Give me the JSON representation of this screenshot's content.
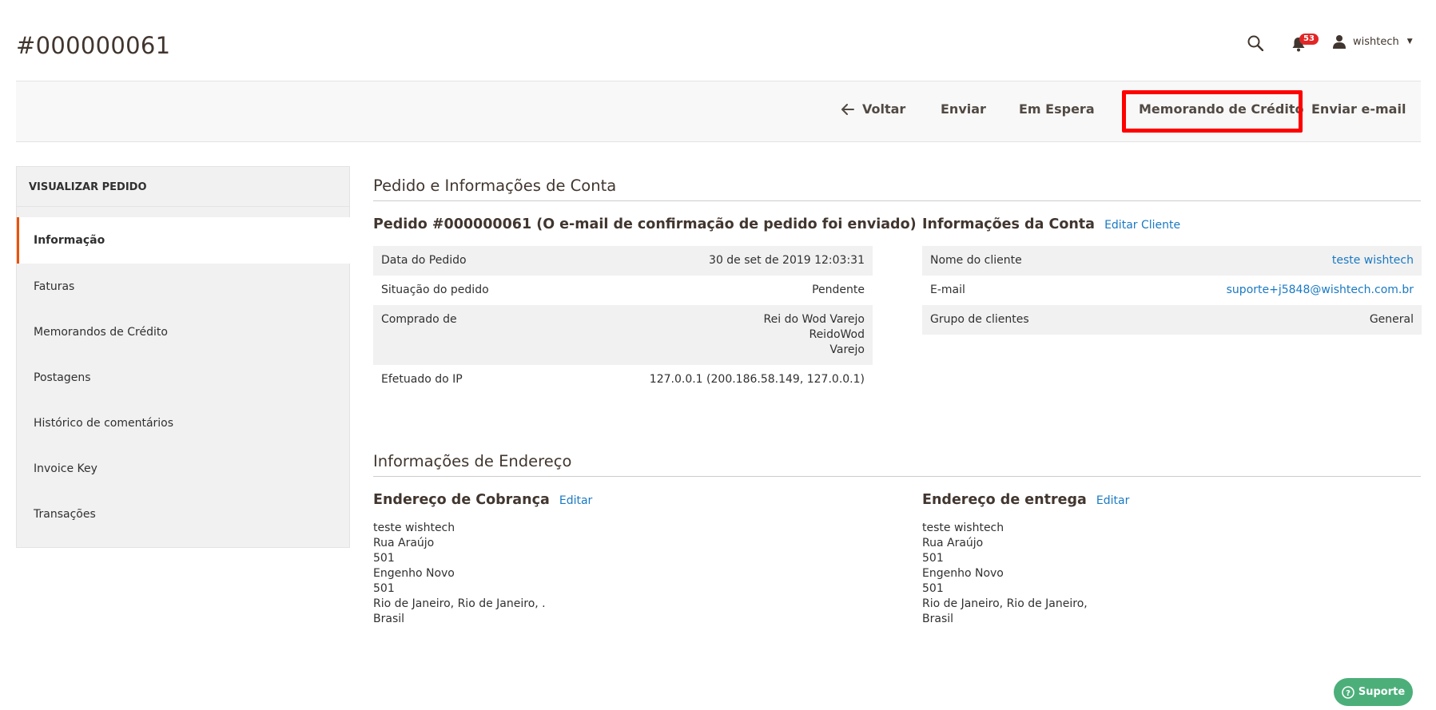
{
  "header": {
    "title": "#000000061",
    "notification_count": "53",
    "user_name": "wishtech"
  },
  "actions": {
    "back": "Voltar",
    "ship": "Enviar",
    "hold": "Em Espera",
    "credit_memo": "Memorando de Crédito",
    "send_email": "Enviar e-mail"
  },
  "sidebar": {
    "title": "VISUALIZAR PEDIDO",
    "items": [
      {
        "label": "Informação"
      },
      {
        "label": "Faturas"
      },
      {
        "label": "Memorandos de Crédito"
      },
      {
        "label": "Postagens"
      },
      {
        "label": "Histórico de comentários"
      },
      {
        "label": "Invoice Key"
      },
      {
        "label": "Transações"
      }
    ]
  },
  "order_section": {
    "title": "Pedido e Informações de Conta",
    "order": {
      "title": "Pedido #000000061 (O e-mail de confirmação de pedido foi enviado)",
      "rows": [
        {
          "label": "Data do Pedido",
          "value": "30 de set de 2019 12:03:31"
        },
        {
          "label": "Situação do pedido",
          "value": "Pendente"
        },
        {
          "label": "Comprado de",
          "value_lines": [
            "Rei do Wod Varejo",
            "ReidoWod",
            "Varejo"
          ]
        },
        {
          "label": "Efetuado do IP",
          "value": "127.0.0.1 (200.186.58.149, 127.0.0.1)"
        }
      ]
    },
    "account": {
      "title": "Informações da Conta",
      "edit_link": "Editar Cliente",
      "rows": [
        {
          "label": "Nome do cliente",
          "value": "teste wishtech"
        },
        {
          "label": "E-mail",
          "value": "suporte+j5848@wishtech.com.br"
        },
        {
          "label": "Grupo de clientes",
          "value": "General"
        }
      ]
    }
  },
  "address_section": {
    "title": "Informações de Endereço",
    "billing": {
      "title": "Endereço de Cobrança",
      "edit_link": "Editar",
      "lines": [
        "teste wishtech",
        "Rua Araújo",
        "501",
        "Engenho Novo",
        "501",
        "Rio de Janeiro, Rio de Janeiro, .",
        "Brasil"
      ]
    },
    "shipping": {
      "title": "Endereço de entrega",
      "edit_link": "Editar",
      "lines": [
        "teste wishtech",
        "Rua Araújo",
        "501",
        "Engenho Novo",
        "501",
        "Rio de Janeiro, Rio de Janeiro,",
        "Brasil"
      ]
    }
  },
  "support_button": "Suporte",
  "colors": {
    "accent_orange": "#eb5202",
    "link_blue": "#1979c3",
    "highlight_red": "#ff0000",
    "support_green": "#4caf7a"
  }
}
